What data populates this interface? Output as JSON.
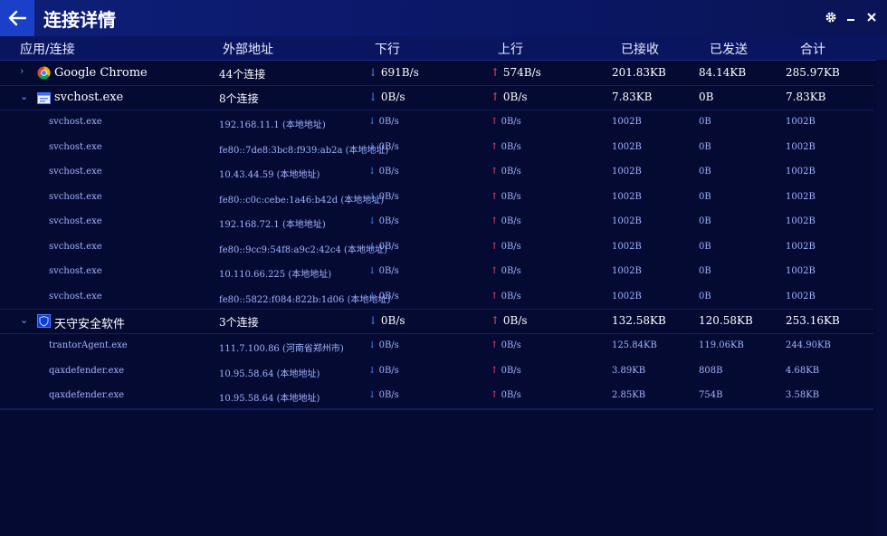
{
  "window": {
    "title": "连接详情"
  },
  "columns": [
    "应用/连接",
    "外部地址",
    "下行",
    "上行",
    "已接收",
    "已发送",
    "合计"
  ],
  "groups": [
    {
      "name": "Google Chrome",
      "icon": "chrome-icon",
      "expanded": false,
      "address": "44个连接",
      "down": "691B/s",
      "up": "574B/s",
      "received": "201.83KB",
      "sent": "84.14KB",
      "total": "285.97KB",
      "children": []
    },
    {
      "name": "svchost.exe",
      "icon": "window-app-icon",
      "expanded": true,
      "address": "8个连接",
      "down": "0B/s",
      "up": "0B/s",
      "received": "7.83KB",
      "sent": "0B",
      "total": "7.83KB",
      "children": [
        {
          "name": "svchost.exe",
          "address": "192.168.11.1 (本地地址)",
          "down": "0B/s",
          "up": "0B/s",
          "received": "1002B",
          "sent": "0B",
          "total": "1002B"
        },
        {
          "name": "svchost.exe",
          "address": "fe80::7de8:3bc8:f939:ab2a (本地地址)",
          "down": "0B/s",
          "up": "0B/s",
          "received": "1002B",
          "sent": "0B",
          "total": "1002B"
        },
        {
          "name": "svchost.exe",
          "address": "10.43.44.59 (本地地址)",
          "down": "0B/s",
          "up": "0B/s",
          "received": "1002B",
          "sent": "0B",
          "total": "1002B"
        },
        {
          "name": "svchost.exe",
          "address": "fe80::c0c:cebe:1a46:b42d (本地地址)",
          "down": "0B/s",
          "up": "0B/s",
          "received": "1002B",
          "sent": "0B",
          "total": "1002B"
        },
        {
          "name": "svchost.exe",
          "address": "192.168.72.1 (本地地址)",
          "down": "0B/s",
          "up": "0B/s",
          "received": "1002B",
          "sent": "0B",
          "total": "1002B"
        },
        {
          "name": "svchost.exe",
          "address": "fe80::9cc9:54f8:a9c2:42c4 (本地地址)",
          "down": "0B/s",
          "up": "0B/s",
          "received": "1002B",
          "sent": "0B",
          "total": "1002B"
        },
        {
          "name": "svchost.exe",
          "address": "10.110.66.225 (本地地址)",
          "down": "0B/s",
          "up": "0B/s",
          "received": "1002B",
          "sent": "0B",
          "total": "1002B"
        },
        {
          "name": "svchost.exe",
          "address": "fe80::5822:f084:822b:1d06 (本地地址)",
          "down": "0B/s",
          "up": "0B/s",
          "received": "1002B",
          "sent": "0B",
          "total": "1002B"
        }
      ]
    },
    {
      "name": "天守安全软件",
      "icon": "shield-app-icon",
      "expanded": true,
      "address": "3个连接",
      "down": "0B/s",
      "up": "0B/s",
      "received": "132.58KB",
      "sent": "120.58KB",
      "total": "253.16KB",
      "children": [
        {
          "name": "trantorAgent.exe",
          "address": "111.7.100.86 (河南省郑州市)",
          "down": "0B/s",
          "up": "0B/s",
          "received": "125.84KB",
          "sent": "119.06KB",
          "total": "244.90KB"
        },
        {
          "name": "qaxdefender.exe",
          "address": "10.95.58.64 (本地地址)",
          "down": "0B/s",
          "up": "0B/s",
          "received": "3.89KB",
          "sent": "808B",
          "total": "4.68KB"
        },
        {
          "name": "qaxdefender.exe",
          "address": "10.95.58.64 (本地地址)",
          "down": "0B/s",
          "up": "0B/s",
          "received": "2.85KB",
          "sent": "754B",
          "total": "3.58KB"
        }
      ]
    }
  ],
  "colors": {
    "accent": "#1a3fc8",
    "down_arrow": "#3d8cff",
    "up_arrow": "#ff4d6a",
    "background": "#050a33"
  }
}
